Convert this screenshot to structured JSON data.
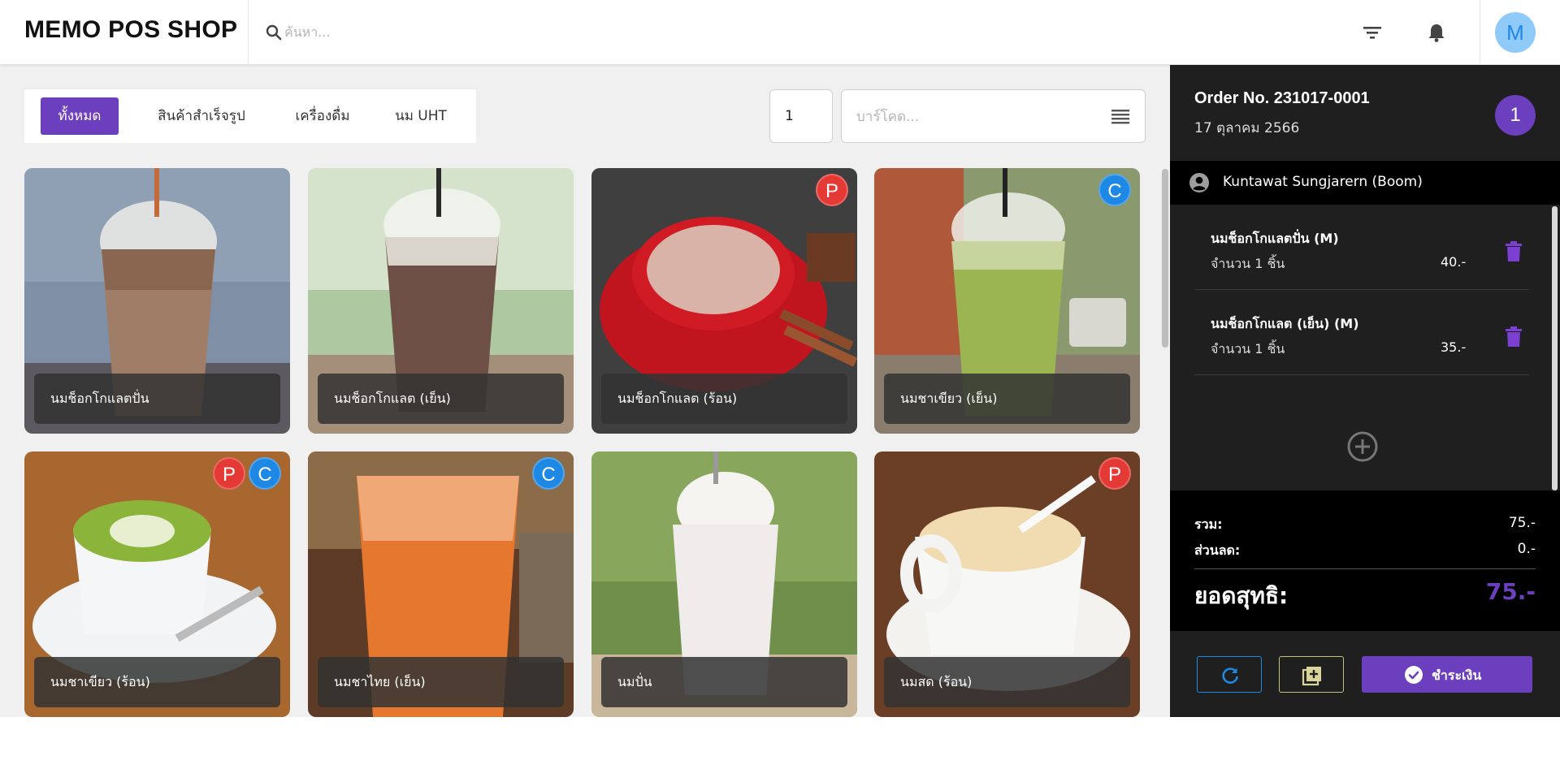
{
  "header": {
    "brand": "MEMO POS SHOP",
    "search_placeholder": "ค้นหา...",
    "avatar_initial": "M"
  },
  "categories": [
    {
      "label": "ทั้งหมด",
      "active": true
    },
    {
      "label": "สินค้าสำเร็จรูป",
      "active": false
    },
    {
      "label": "เครื่องดื่ม",
      "active": false
    },
    {
      "label": "นม UHT",
      "active": false
    }
  ],
  "quantity_value": "1",
  "barcode_placeholder": "บาร์โคด...",
  "products": [
    {
      "name": "นมช็อกโกแลตปั่น",
      "badges": []
    },
    {
      "name": "นมช็อกโกแลต (เย็น)",
      "badges": []
    },
    {
      "name": "นมช็อกโกแลต (ร้อน)",
      "badges": [
        "P"
      ]
    },
    {
      "name": "นมชาเขียว (เย็น)",
      "badges": [
        "C"
      ]
    },
    {
      "name": "นมชาเขียว (ร้อน)",
      "badges": [
        "P",
        "C"
      ]
    },
    {
      "name": "นมชาไทย (เย็น)",
      "badges": [
        "C"
      ]
    },
    {
      "name": "นมปั่น",
      "badges": []
    },
    {
      "name": "นมสด (ร้อน)",
      "badges": [
        "P"
      ]
    }
  ],
  "order": {
    "number": "Order No. 231017-0001",
    "date": "17 ตุลาคม 2566",
    "item_count": "1",
    "customer": "Kuntawat Sungjarern (Boom)",
    "items": [
      {
        "name": "นมช็อกโกแลตปั่น (M)",
        "qty": "จำนวน 1 ชิ้น",
        "price": "40.-"
      },
      {
        "name": "นมช็อกโกแลต (เย็น) (M)",
        "qty": "จำนวน 1 ชิ้น",
        "price": "35.-"
      }
    ],
    "subtotal_label": "รวม:",
    "subtotal": "75.-",
    "discount_label": "ส่วนลด:",
    "discount": "0.-",
    "net_label": "ยอดสุทธิ:",
    "net": "75.-",
    "pay_label": "ชำระเงิน"
  },
  "colors": {
    "accent": "#6c3fbf",
    "badge_p": "#e53935",
    "badge_c": "#1e88e5",
    "panel_bg": "#1f1f1f"
  }
}
